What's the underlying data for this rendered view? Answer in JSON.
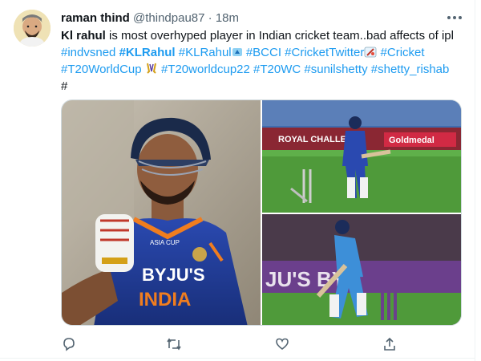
{
  "tweet": {
    "author": {
      "display_name": "raman thind",
      "handle": "@thindpau87",
      "separator": "·",
      "time": "18m"
    },
    "text": {
      "line1_bold": "Kl rahul",
      "line1_rest": " is most overhyped player in Indian cricket team..bad affects of ipl",
      "hashtags_line2": [
        "#indvsned",
        "#KLRahul",
        "#KLRahul",
        "#BCCI",
        "#CricketTwitter",
        "#Cricket"
      ],
      "hashtags_line3": [
        "#T20WorldCup",
        "#T20worldcup22",
        "#T20WC",
        "#sunilshetty",
        "#shetty_rishab"
      ],
      "line4": "#"
    },
    "media": {
      "left_photo": {
        "jersey_sponsor": "BYJU'S",
        "jersey_country": "INDIA",
        "badge_text": "ASIA CUP"
      },
      "top_right_photo": {
        "board1": "ROYAL CHALLEN",
        "board2": "Goldmedal"
      },
      "bottom_right_photo": {
        "board": "JU'S   BY"
      }
    },
    "actions": {
      "reply_icon": "reply-icon",
      "retweet_icon": "retweet-icon",
      "like_icon": "heart-icon",
      "share_icon": "share-icon"
    },
    "colors": {
      "link": "#1d9bf0",
      "secondary": "#536471",
      "jersey": "#1f3a93",
      "pitch": "#4f9a3a"
    }
  }
}
